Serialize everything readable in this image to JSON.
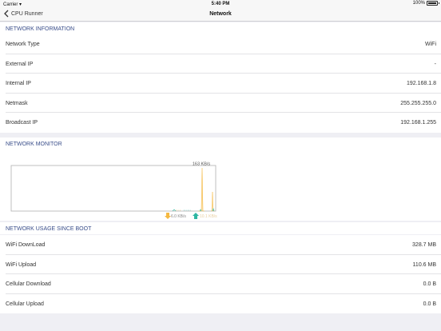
{
  "status_bar": {
    "carrier": "Carrier",
    "time": "5:40 PM",
    "battery_percent": "100%",
    "battery_level": 1.0
  },
  "nav": {
    "back_label": "CPU Runner",
    "title": "Network"
  },
  "network_info": {
    "header": "NETWORK INFORMATION",
    "rows": [
      {
        "label": "Network Type",
        "value": "WiFi"
      },
      {
        "label": "External IP",
        "value": "-"
      },
      {
        "label": "Internal IP",
        "value": "192.168.1.8"
      },
      {
        "label": "Netmask",
        "value": "255.255.255.0"
      },
      {
        "label": "Broadcast IP",
        "value": "192.168.1.255"
      }
    ]
  },
  "network_monitor": {
    "header": "NETWORK MONITOR",
    "peak_label": "163 KB/s",
    "download_label": "6.0 KB/s",
    "upload_label": "10.1 KB/s",
    "colors": {
      "download": "#f5b942",
      "upload": "#2fb7a3",
      "frame": "#b0b0b0"
    }
  },
  "usage": {
    "header": "NETWORK USAGE SINCE BOOT",
    "rows": [
      {
        "label": "WiFi DownLoad",
        "value": "328.7 MB"
      },
      {
        "label": "WiFi Upload",
        "value": "110.6 MB"
      },
      {
        "label": "Cellular Download",
        "value": "0.0 B"
      },
      {
        "label": "Cellular Upload",
        "value": "0.0 B"
      }
    ]
  }
}
